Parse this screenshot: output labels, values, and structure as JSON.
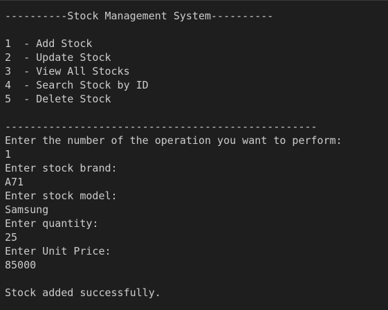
{
  "terminal": {
    "header": "----------Stock Management System----------",
    "menu": [
      "1  - Add Stock",
      "2  - Update Stock",
      "3  - View All Stocks",
      "4  - Search Stock by ID",
      "5  - Delete Stock"
    ],
    "separator": "--------------------------------------------------",
    "prompt_operation": "Enter the number of the operation you want to perform:",
    "input_operation": "1",
    "prompt_brand": "Enter stock brand:",
    "input_brand": "A71",
    "prompt_model": "Enter stock model:",
    "input_model": "Samsung",
    "prompt_quantity": "Enter quantity:",
    "input_quantity": "25",
    "prompt_price": "Enter Unit Price:",
    "input_price": "85000",
    "result": "Stock added successfully."
  },
  "colors": {
    "background": "#1e1e1e",
    "text": "#cccccc"
  }
}
